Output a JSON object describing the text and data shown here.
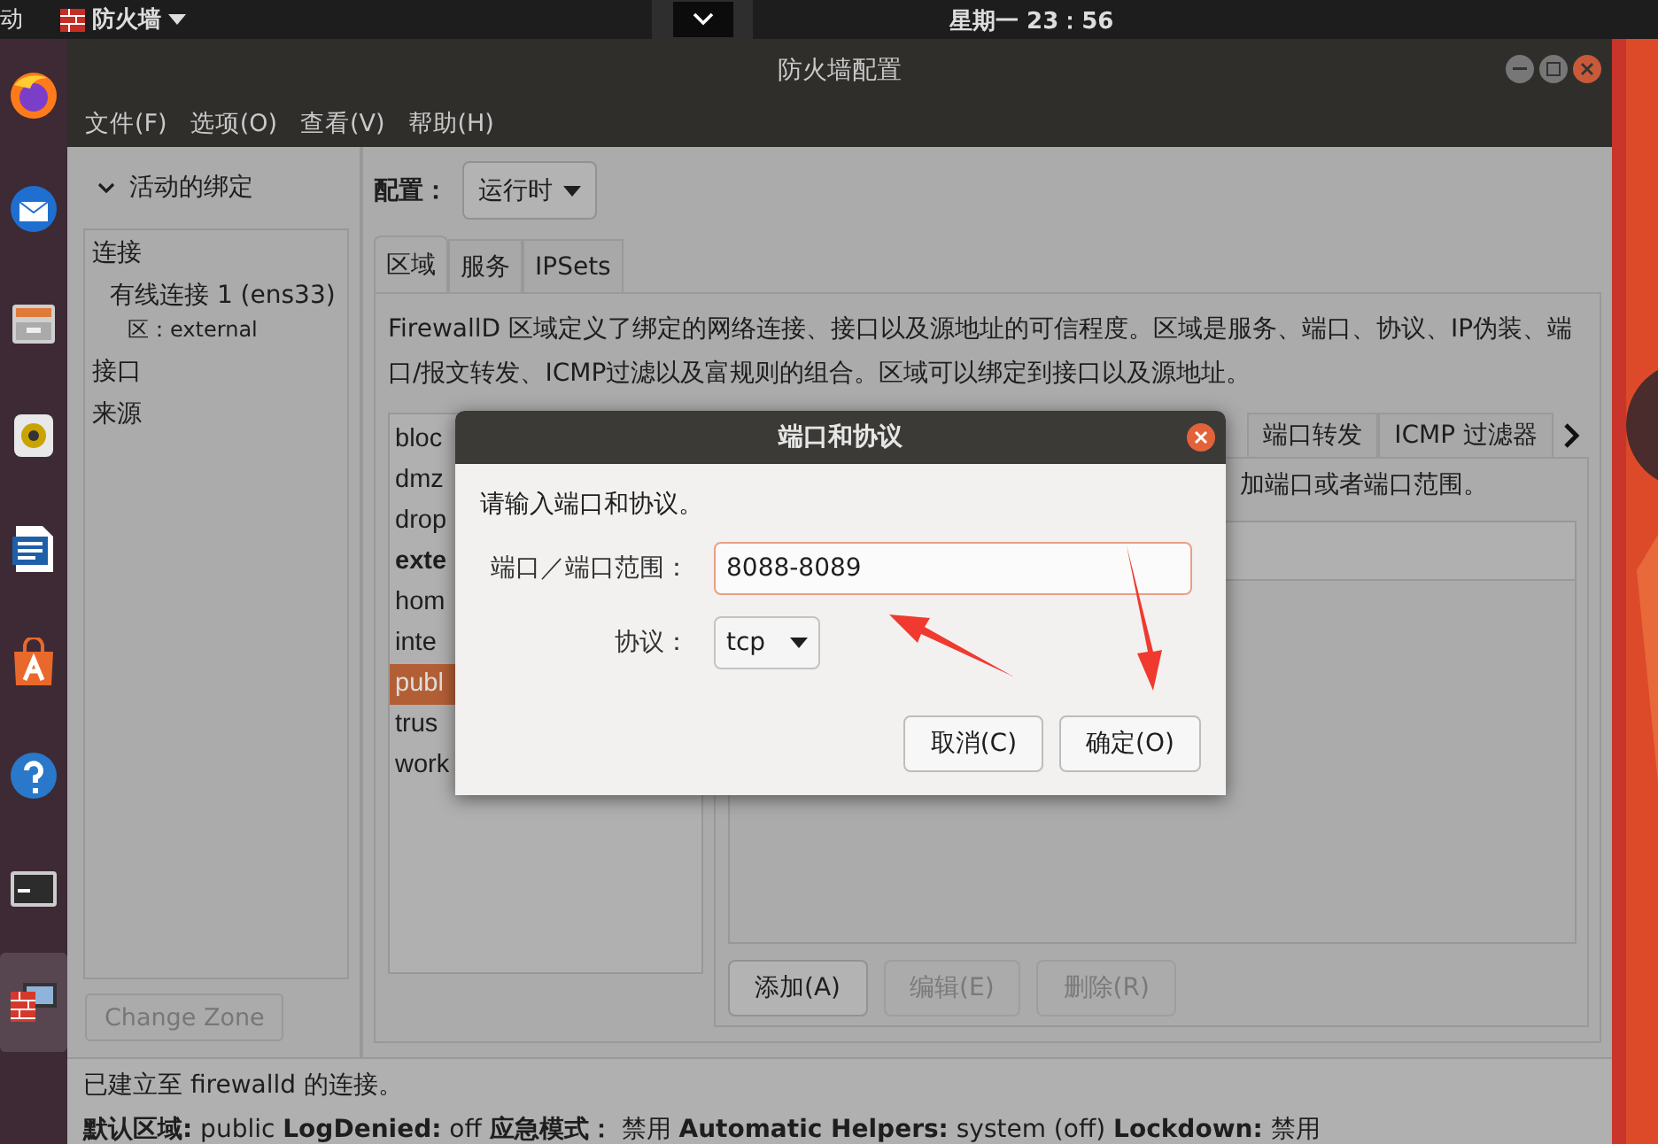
{
  "top_bar": {
    "activities": "动",
    "app_menu": "防火墙",
    "clock": "星期一 23：56"
  },
  "dock": [
    {
      "kind": "browser",
      "selected": false
    },
    {
      "kind": "mail",
      "selected": false
    },
    {
      "kind": "files",
      "selected": false
    },
    {
      "kind": "music",
      "selected": false
    },
    {
      "kind": "writer",
      "selected": false
    },
    {
      "kind": "store",
      "selected": false
    },
    {
      "kind": "help",
      "selected": false
    },
    {
      "kind": "terminal",
      "selected": false
    },
    {
      "kind": "firewall",
      "selected": true
    }
  ],
  "window": {
    "title": "防火墙配置",
    "menu": [
      "文件(F)",
      "选项(O)",
      "查看(V)",
      "帮助(H)"
    ]
  },
  "bindings": {
    "header": "活动的绑定",
    "expanded": true,
    "groups": [
      {
        "label": "连接",
        "children": [
          {
            "label": "有线连接 1 (ens33)",
            "detail": "区：external"
          }
        ]
      },
      {
        "label": "接口"
      },
      {
        "label": "来源"
      }
    ],
    "change_zone": {
      "label": "Change Zone",
      "disabled": true
    }
  },
  "config": {
    "label": "配置：",
    "value": "运行时"
  },
  "tabs": [
    {
      "label": "区域",
      "selected": true
    },
    {
      "label": "服务",
      "selected": false
    },
    {
      "label": "IPSets",
      "selected": false
    }
  ],
  "zone_description": "FirewallD 区域定义了绑定的网络连接、接口以及源地址的可信程度。区域是服务、端口、协议、IP伪装、端口/报文转发、ICMP过滤以及富规则的组合。区域可以绑定到接口以及源地址。",
  "zones": [
    {
      "name": "bloc",
      "selected": false,
      "active": false
    },
    {
      "name": "dmz",
      "selected": false,
      "active": false
    },
    {
      "name": "drop",
      "selected": false,
      "active": false
    },
    {
      "name": "exte",
      "selected": false,
      "active": true
    },
    {
      "name": "hom",
      "selected": false,
      "active": false
    },
    {
      "name": "inte",
      "selected": false,
      "active": false
    },
    {
      "name": "publ",
      "selected": true,
      "active": false
    },
    {
      "name": "trus",
      "selected": false,
      "active": false
    },
    {
      "name": "work",
      "selected": false,
      "active": false
    }
  ],
  "zone_tabs": [
    "端口转发",
    "ICMP 过滤器"
  ],
  "zone_tab_hint": "加端口或者端口范围。",
  "port_buttons": [
    {
      "label": "添加(A)",
      "disabled": false
    },
    {
      "label": "编辑(E)",
      "disabled": true
    },
    {
      "label": "删除(R)",
      "disabled": true
    }
  ],
  "status": {
    "message": "已建立至 firewalld 的连接。",
    "details": "**默认区域:** public  **LogDenied:** off  **应急模式：** 禁用  **Automatic Helpers:** system (off)  **Lockdown:** 禁用"
  },
  "dialog": {
    "title": "端口和协议",
    "prompt": "请输入端口和协议。",
    "port_label": "端口／端口范围：",
    "port_value": "8088-8089",
    "protocol_label": "协议：",
    "protocol": "tcp",
    "buttons": [
      "取消(C)",
      "确定(O)"
    ]
  }
}
